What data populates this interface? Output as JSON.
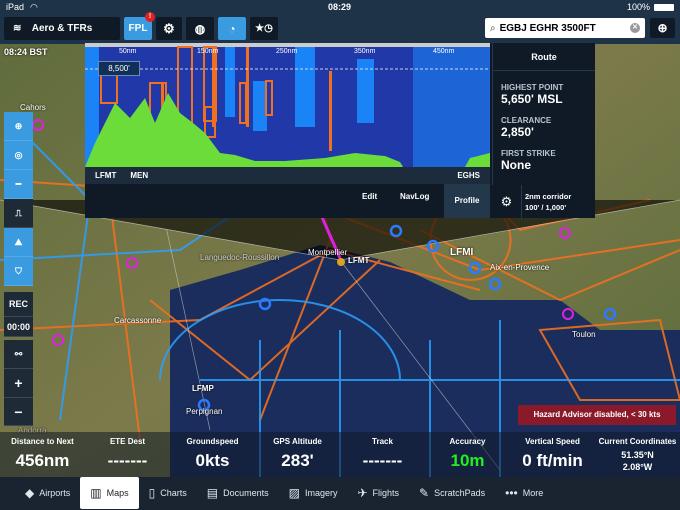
{
  "status": {
    "device": "iPad",
    "time": "08:29",
    "battery": "100%"
  },
  "toolbar": {
    "layers_label": "Aero & TFRs",
    "fpl_label": "FPL",
    "fpl_badge": "!"
  },
  "search": {
    "value": "EGBJ EGHR 3500FT"
  },
  "map": {
    "clock": "08:24 BST",
    "labels": [
      "Cahors",
      "Languedoc-Roussillon",
      "Montpellier",
      "LFMT",
      "LFMI",
      "Aix-en-Provence",
      "Carcassonne",
      "Toulon",
      "LFMP",
      "Perpignan",
      "Andorra"
    ],
    "hazard": "Hazard Advisor disabled, < 30 kts"
  },
  "profile": {
    "distances": [
      "50nm",
      "150nm",
      "250nm",
      "350nm",
      "450nm"
    ],
    "altitude": "8,500'",
    "waypoints": [
      "LFMT",
      "MEN",
      "EGHS"
    ],
    "tabs": [
      "Edit",
      "NavLog",
      "Profile"
    ],
    "selected_tab": "Profile",
    "route_title": "Route",
    "highest_label": "HIGHEST POINT",
    "highest": "5,650' MSL",
    "clearance_label": "CLEARANCE",
    "clearance": "2,850'",
    "strike_label": "FIRST STRIKE",
    "strike": "None",
    "corridor": "2nm corridor",
    "corridor_vals": "100' / 1,000'"
  },
  "left_tools": {
    "rec": "REC",
    "timer": "00:00"
  },
  "instruments": [
    {
      "label": "Distance to Next",
      "value": "456nm"
    },
    {
      "label": "ETE Dest",
      "value": "-------"
    },
    {
      "label": "Groundspeed",
      "value": "0kts"
    },
    {
      "label": "GPS Altitude",
      "value": "283'"
    },
    {
      "label": "Track",
      "value": "-------"
    },
    {
      "label": "Accuracy",
      "value": "10m",
      "color": "#22ee22"
    },
    {
      "label": "Vertical Speed",
      "value": "0 ft/min"
    },
    {
      "label": "Current Coordinates",
      "value": "51.35°N",
      "value2": "2.08°W"
    }
  ],
  "tabs": [
    {
      "label": "Airports",
      "icon": "airports-icon"
    },
    {
      "label": "Maps",
      "icon": "maps-icon",
      "selected": true
    },
    {
      "label": "Charts",
      "icon": "charts-icon"
    },
    {
      "label": "Documents",
      "icon": "documents-icon"
    },
    {
      "label": "Imagery",
      "icon": "imagery-icon"
    },
    {
      "label": "Flights",
      "icon": "flights-icon"
    },
    {
      "label": "ScratchPads",
      "icon": "scratchpads-icon"
    },
    {
      "label": "More",
      "icon": "more-icon"
    }
  ],
  "colors": {
    "accent": "#3a9be0",
    "airspace_orange": "#f07020",
    "airspace_blue": "#2aa0ff",
    "terrain": "#6cdc3a"
  }
}
